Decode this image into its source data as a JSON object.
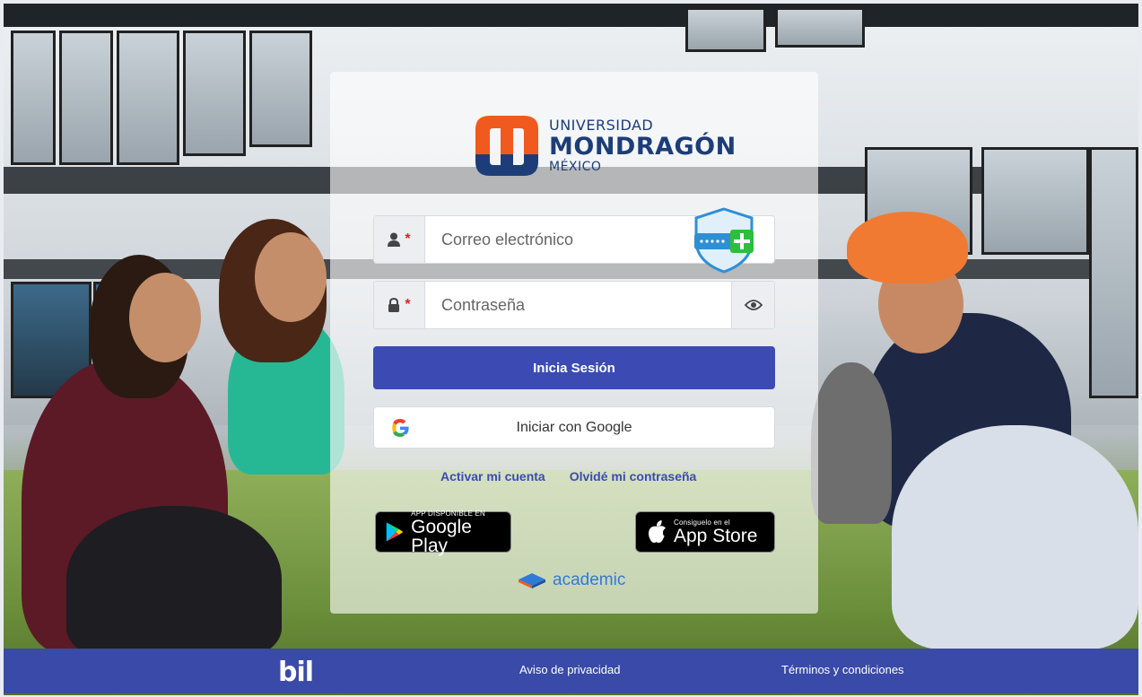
{
  "login": {
    "email_placeholder": "Correo electrónico",
    "password_placeholder": "Contraseña",
    "required_mark": "*",
    "submit_label": "Inicia Sesión",
    "google_label": "Iniciar con Google",
    "activate_link": "Activar mi cuenta",
    "forgot_link": "Olvidé mi contraseña"
  },
  "logo": {
    "line1": "UNIVERSIDAD",
    "line2": "MONDRAGÓN",
    "line3": "MÉXICO",
    "colors": {
      "orange": "#f05a1e",
      "blue": "#1d3d78"
    }
  },
  "stores": {
    "google_play": {
      "small": "APP DISPONIBLE EN",
      "big": "Google Play"
    },
    "app_store": {
      "small": "Consiguelo en el",
      "big": "App Store"
    }
  },
  "powered_by": "academic",
  "footer": {
    "brand": "bil",
    "privacy_label": "Aviso de privacidad",
    "terms_label": "Términos y condiciones"
  },
  "colors": {
    "primary": "#3b4bb3",
    "footer": "#3a4aa8",
    "link": "#3b4bb3",
    "academic": "#2f7ad6"
  },
  "icons": [
    "user-icon",
    "lock-icon",
    "eye-icon",
    "google-icon",
    "password-manager-icon",
    "apple-icon",
    "google-play-icon",
    "academic-logo-icon"
  ]
}
